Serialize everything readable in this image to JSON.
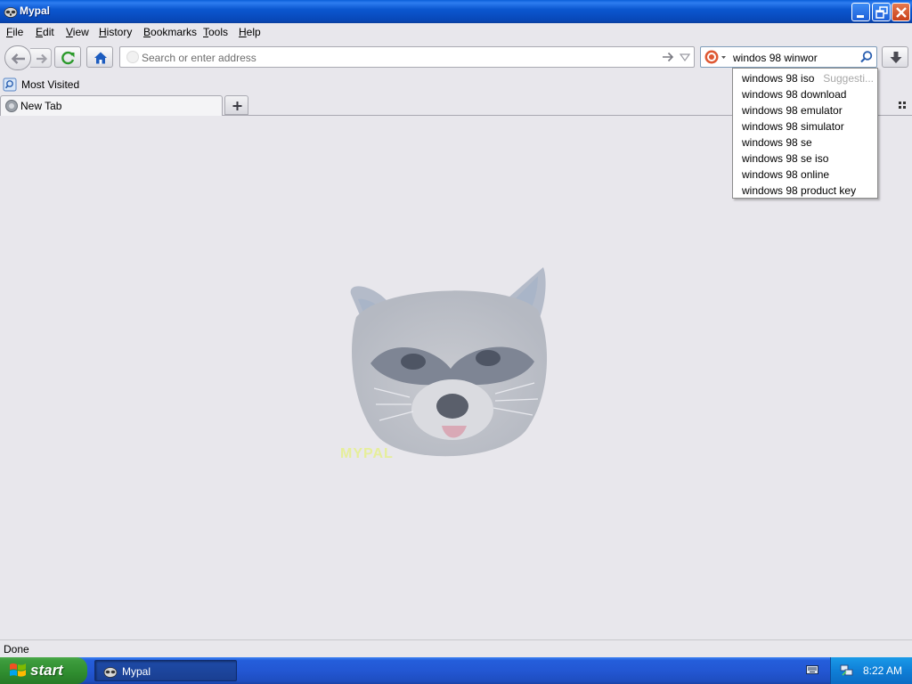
{
  "window": {
    "title": "Mypal"
  },
  "menu": {
    "items": [
      {
        "label": "File",
        "key": "F",
        "rest": "ile"
      },
      {
        "label": "Edit",
        "key": "E",
        "rest": "dit"
      },
      {
        "label": "View",
        "key": "V",
        "rest": "iew"
      },
      {
        "label": "History",
        "key": "H",
        "rest": "istory"
      },
      {
        "label": "Bookmarks",
        "key": "B",
        "rest": "ookmarks"
      },
      {
        "label": "Tools",
        "key": "T",
        "rest": "ools"
      },
      {
        "label": "Help",
        "key": "H",
        "rest": "elp"
      }
    ]
  },
  "navbar": {
    "url_placeholder": "Search or enter address",
    "url_value": "",
    "search_value": "windos 98 winwor"
  },
  "bookmarks": {
    "most_visited": "Most Visited"
  },
  "tabs": [
    {
      "label": "New Tab"
    }
  ],
  "suggestions": {
    "header": "Suggesti...",
    "items": [
      "windows 98 iso",
      "windows 98 download",
      "windows 98 emulator",
      "windows 98 simulator",
      "windows 98 se",
      "windows 98 se iso",
      "windows 98 online",
      "windows 98 product key"
    ]
  },
  "content": {
    "logo_text": "MYPAL"
  },
  "status": {
    "text": "Done"
  },
  "taskbar": {
    "start_label": "start",
    "task_label": "Mypal",
    "clock": "8:22 AM"
  },
  "colors": {
    "titlebar": "#0b57d0",
    "chrome_bg": "#e8e7ec",
    "taskbar": "#245edb",
    "start_green": "#3c9b3c",
    "tray": "#0f7fd7"
  }
}
